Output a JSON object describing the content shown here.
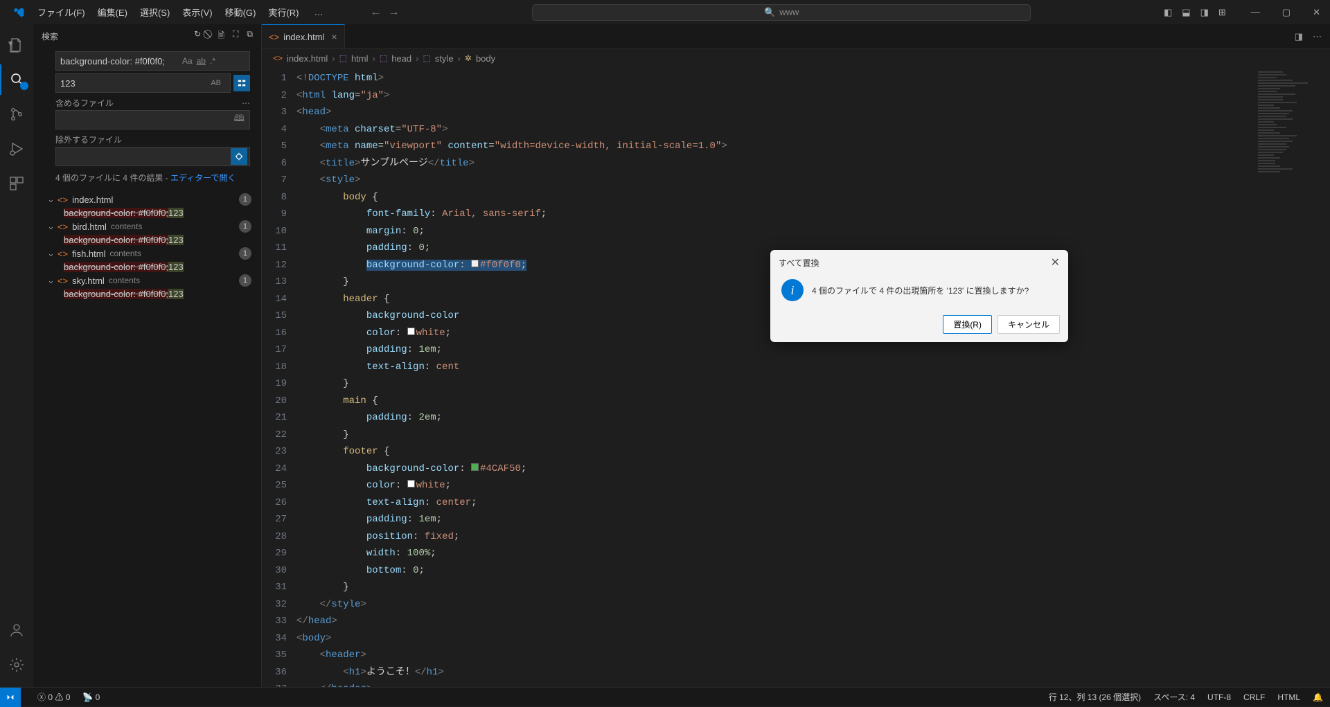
{
  "titlebar": {
    "menus": [
      "ファイル(F)",
      "編集(E)",
      "選択(S)",
      "表示(V)",
      "移動(G)",
      "実行(R)"
    ],
    "dots": "…",
    "search_placeholder": "www"
  },
  "sidebar": {
    "title": "検索",
    "search_value": "background-color: #f0f0f0;",
    "replace_value": "123",
    "include_label": "含めるファイル",
    "exclude_label": "除外するファイル",
    "summary_prefix": "4 個のファイルに 4 件の結果 - ",
    "summary_link": "エディターで開く",
    "ab_badge": "AB",
    "match_controls": {
      "aa": "Aa",
      "ab": "ab",
      "re": ".*"
    }
  },
  "results": [
    {
      "file": "index.html",
      "path": "",
      "count": "1",
      "match_old": "background-color: #f0f0f0;",
      "match_new": "123"
    },
    {
      "file": "bird.html",
      "path": "contents",
      "count": "1",
      "match_old": "background-color: #f0f0f0;",
      "match_new": "123"
    },
    {
      "file": "fish.html",
      "path": "contents",
      "count": "1",
      "match_old": "background-color: #f0f0f0;",
      "match_new": "123"
    },
    {
      "file": "sky.html",
      "path": "contents",
      "count": "1",
      "match_old": "background-color: #f0f0f0;",
      "match_new": "123"
    }
  ],
  "tab": {
    "name": "index.html"
  },
  "breadcrumbs": [
    "index.html",
    "html",
    "head",
    "style",
    "body"
  ],
  "dialog": {
    "title": "すべて置換",
    "message": "4 個のファイルで 4 件の出現箇所を '123' に置換しますか?",
    "ok": "置換(R)",
    "cancel": "キャンセル"
  },
  "status": {
    "errors": "0",
    "warnings": "0",
    "ports": "0",
    "cursor": "行 12、列 13 (26 個選択)",
    "spaces": "スペース: 4",
    "encoding": "UTF-8",
    "eol": "CRLF",
    "lang": "HTML"
  },
  "code_meta": {
    "title_text": "サンプルページ",
    "h1_text": "ようこそ！",
    "colors": {
      "f0f0f0": "#f0f0f0",
      "g50": "#4CAF50",
      "white": "white"
    }
  }
}
